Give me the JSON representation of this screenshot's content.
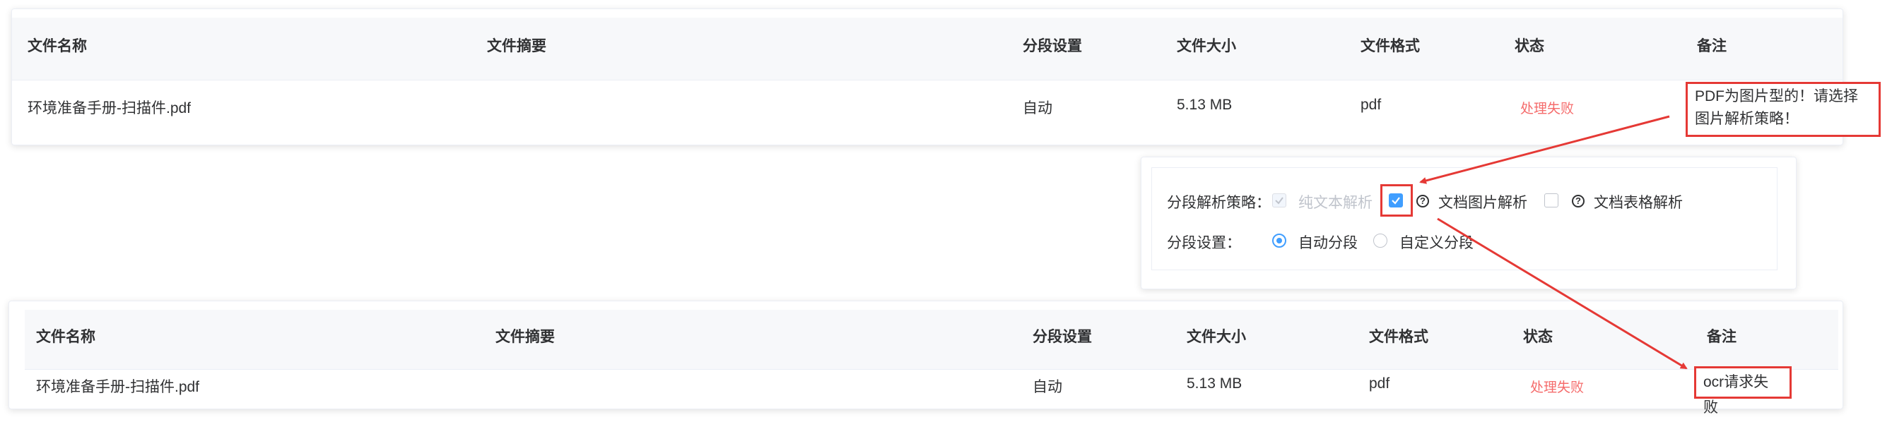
{
  "table": {
    "headers": [
      "文件名称",
      "文件摘要",
      "分段设置",
      "文件大小",
      "文件格式",
      "状态",
      "备注"
    ],
    "row_before": {
      "name": "环境准备手册-扫描件.pdf",
      "summary": "",
      "segment": "自动",
      "size": "5.13 MB",
      "format": "pdf",
      "status": "处理失败",
      "note_line1": "PDF为图片型的！请选择",
      "note_line2": "图片解析策略！"
    },
    "row_after": {
      "name": "环境准备手册-扫描件.pdf",
      "summary": "",
      "segment": "自动",
      "size": "5.13 MB",
      "format": "pdf",
      "status": "处理失败",
      "note": "ocr请求失败"
    }
  },
  "popup": {
    "strategy_label": "分段解析策略：",
    "opt_text": "纯文本解析",
    "opt_text_checked": true,
    "opt_text_disabled": true,
    "opt_image": "文档图片解析",
    "opt_image_checked": true,
    "opt_table": "文档表格解析",
    "opt_table_checked": false,
    "segment_label": "分段设置：",
    "seg_auto": "自动分段",
    "seg_custom": "自定义分段",
    "selected_segment": "自动分段"
  },
  "colors": {
    "accent": "#409eff",
    "status_fail": "#f56c6c",
    "annotation": "#e53935"
  }
}
